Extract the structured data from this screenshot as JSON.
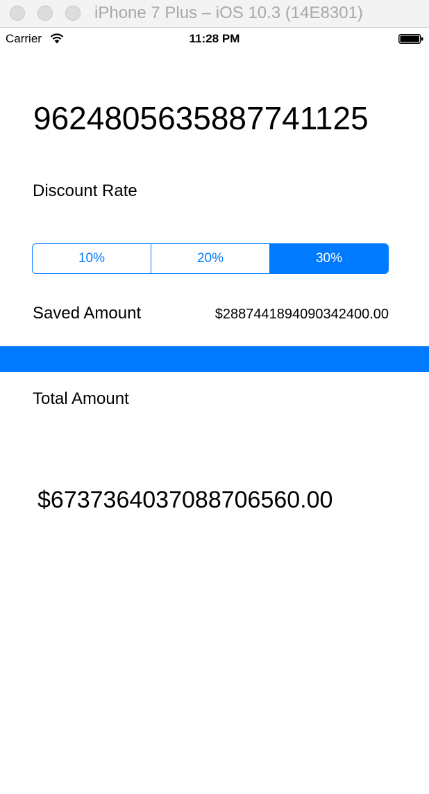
{
  "window": {
    "title": "iPhone 7 Plus – iOS 10.3 (14E8301)"
  },
  "status_bar": {
    "carrier": "Carrier",
    "time": "11:28 PM",
    "icons": [
      "wifi-icon",
      "battery-icon"
    ]
  },
  "bill": {
    "amount": "9624805635887741125"
  },
  "discount": {
    "label": "Discount Rate",
    "options": [
      "10%",
      "20%",
      "30%"
    ],
    "selected": "30%"
  },
  "saved": {
    "label": "Saved Amount",
    "value": "$2887441894090342400.00"
  },
  "total": {
    "label": "Total Amount",
    "value": "$6737364037088706560.00"
  },
  "colors": {
    "accent": "#007aff",
    "background": "#ffffff",
    "text": "#000000"
  }
}
